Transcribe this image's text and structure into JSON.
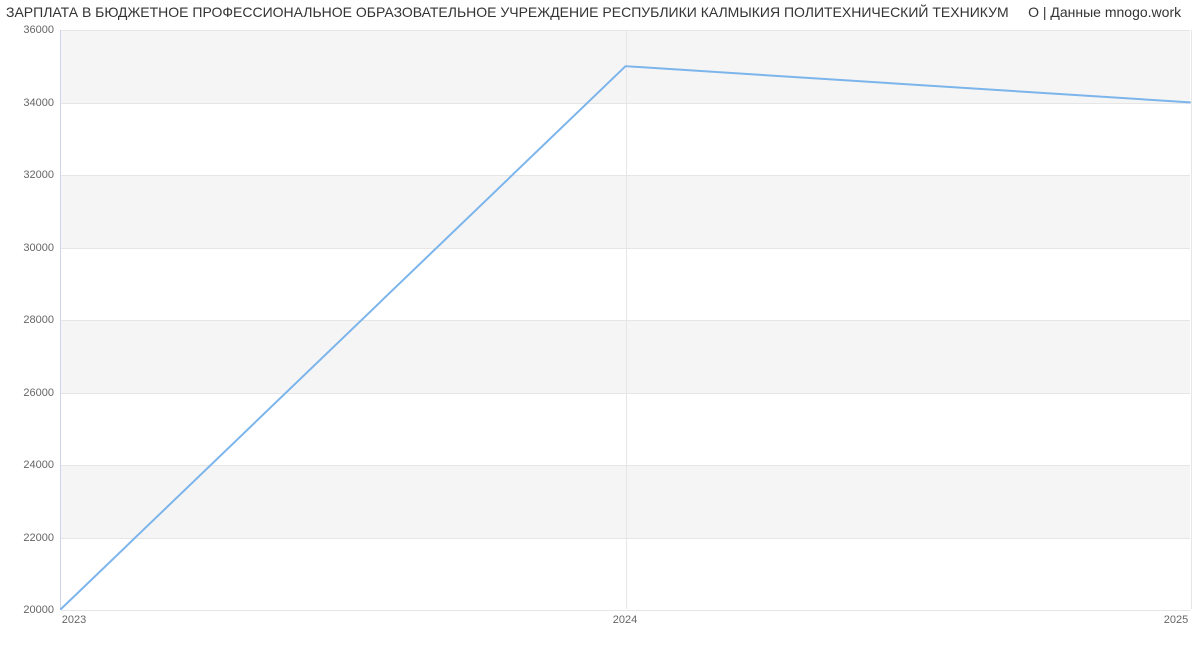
{
  "title_main": "ЗАРПЛАТА В БЮДЖЕТНОЕ ПРОФЕССИОНАЛЬНОЕ ОБРАЗОВАТЕЛЬНОЕ УЧРЕЖДЕНИЕ РЕСПУБЛИКИ КАЛМЫКИЯ ПОЛИТЕХНИЧЕСКИЙ ТЕХНИКУМ",
  "title_suffix": "О | Данные mnogo.work",
  "y_ticks": [
    "20000",
    "22000",
    "24000",
    "26000",
    "28000",
    "30000",
    "32000",
    "34000",
    "36000"
  ],
  "x_ticks": [
    "2023",
    "2024",
    "2025"
  ],
  "chart_data": {
    "type": "line",
    "title": "ЗАРПЛАТА В БЮДЖЕТНОЕ ПРОФЕССИОНАЛЬНОЕ ОБРАЗОВАТЕЛЬНОЕ УЧРЕЖДЕНИЕ РЕСПУБЛИКИ КАЛМЫКИЯ ПОЛИТЕХНИЧЕСКИЙ ТЕХНИКУМ | Данные mnogo.work",
    "xlabel": "",
    "ylabel": "",
    "x": [
      2023,
      2024,
      2025
    ],
    "values": [
      20000,
      35000,
      34000
    ],
    "xlim": [
      2023,
      2025
    ],
    "ylim": [
      20000,
      36000
    ],
    "grid": true,
    "line_color": "#7cb5ec"
  }
}
